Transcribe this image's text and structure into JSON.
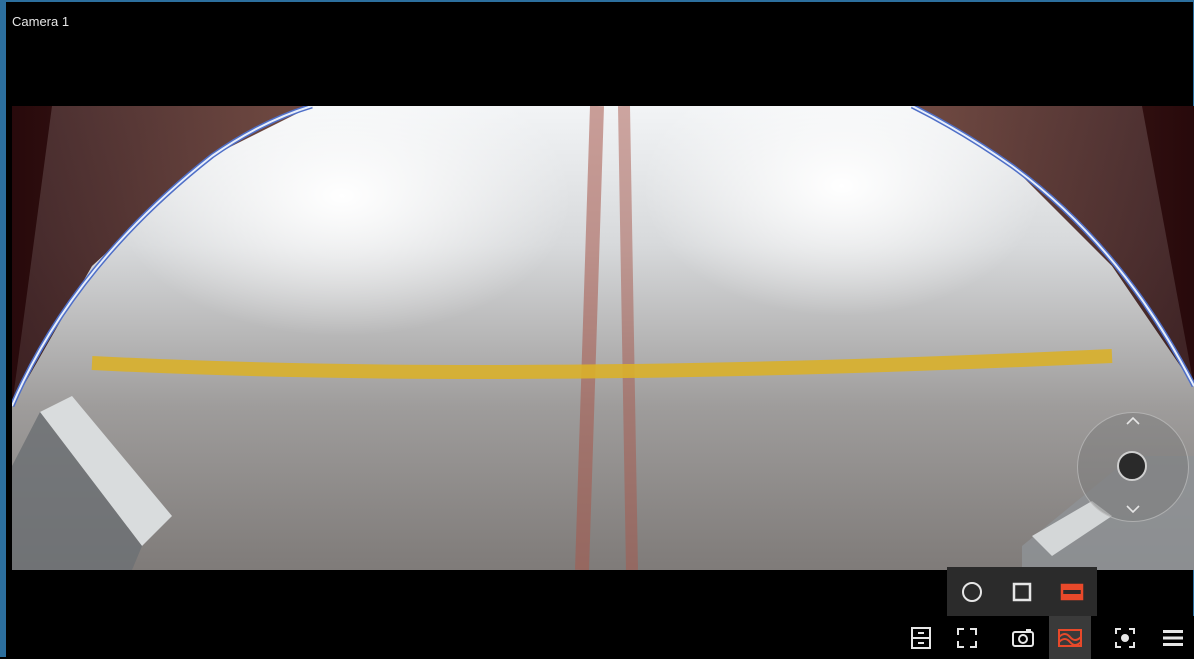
{
  "camera": {
    "title": "Camera 1"
  },
  "colors": {
    "accent": "#e8492a",
    "frame_border": "#2c6f9e",
    "panel_background": "#2b2b2b",
    "icon": "#e6e6e6"
  },
  "ptz_joystick": {
    "up_icon": "chevron-up-icon",
    "down_icon": "chevron-down-icon",
    "knob_icon": "joystick-knob"
  },
  "view_modes": [
    {
      "id": "circle",
      "icon": "circle-icon",
      "active": false
    },
    {
      "id": "square",
      "icon": "square-icon",
      "active": false
    },
    {
      "id": "panorama",
      "icon": "panorama-rectangle-icon",
      "active": true
    }
  ],
  "toolbar": [
    {
      "id": "layout",
      "icon": "split-layout-icon",
      "active": false
    },
    {
      "id": "fullscreen",
      "icon": "fullscreen-icon",
      "active": false
    },
    {
      "id": "snapshot",
      "icon": "camera-icon",
      "active": false
    },
    {
      "id": "dewarp",
      "icon": "dewarp-icon",
      "active": true
    },
    {
      "id": "focus",
      "icon": "focus-icon",
      "active": false
    },
    {
      "id": "menu",
      "icon": "menu-icon",
      "active": false
    }
  ]
}
